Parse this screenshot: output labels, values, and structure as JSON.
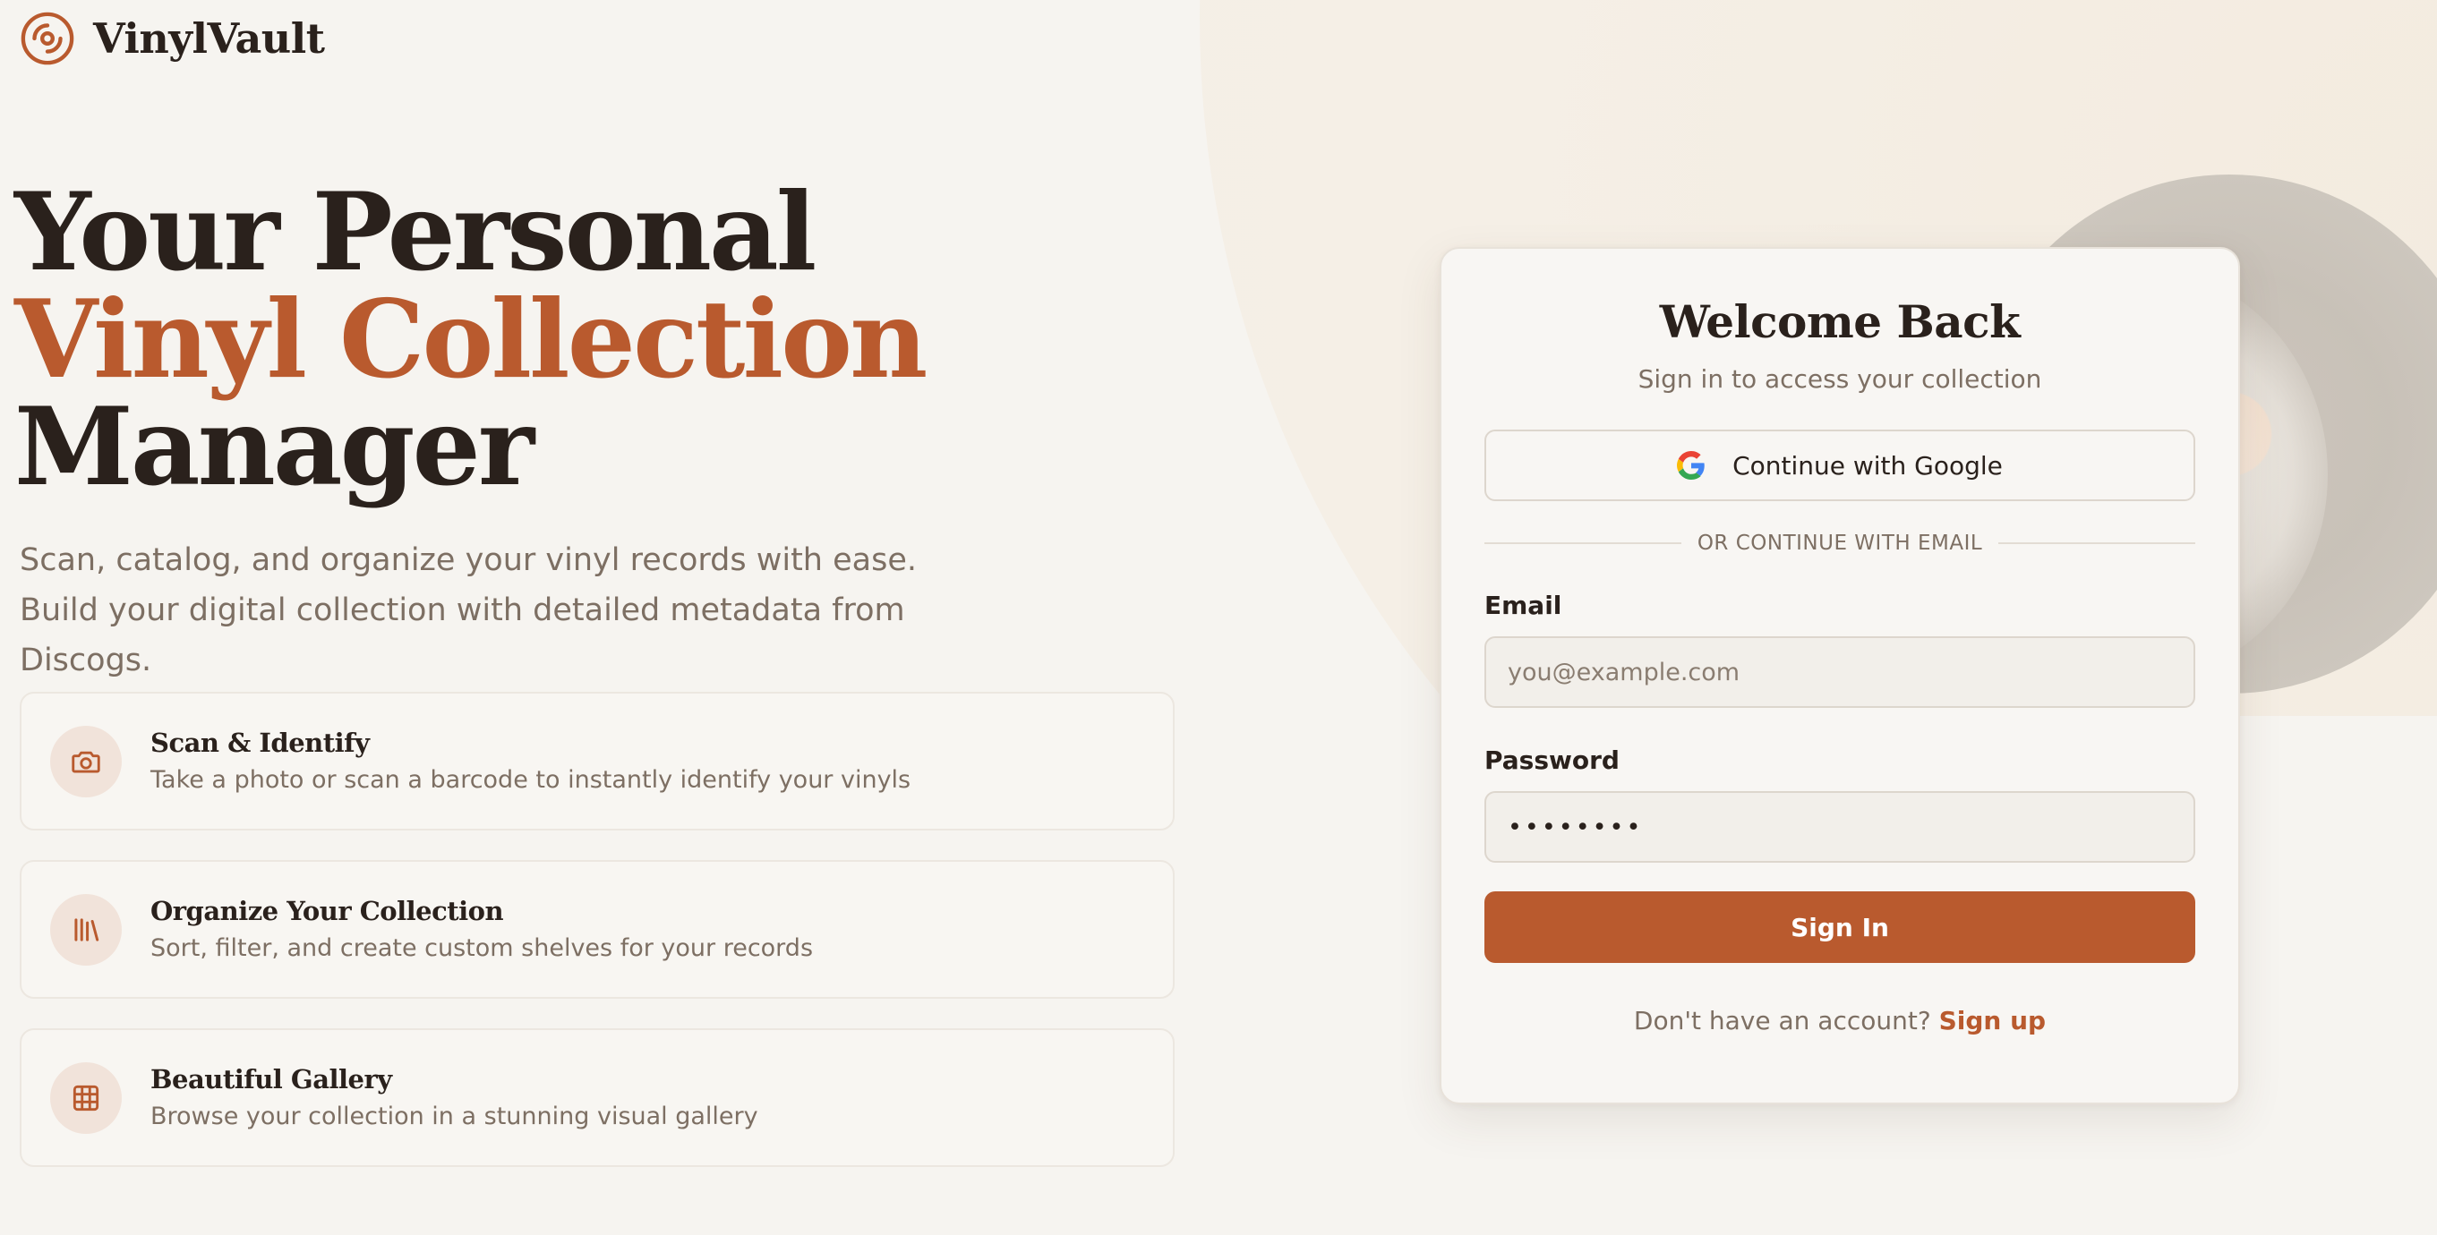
{
  "brand": {
    "name": "VinylVault",
    "icon": "disc-icon"
  },
  "hero": {
    "title_line1": "Your Personal",
    "title_line2": "Vinyl Collection",
    "title_line3": "Manager",
    "subtitle": "Scan, catalog, and organize your vinyl records with ease. Build your digital collection with detailed metadata from Discogs."
  },
  "features": [
    {
      "icon": "camera-icon",
      "title": "Scan & Identify",
      "description": "Take a photo or scan a barcode to instantly identify your vinyls"
    },
    {
      "icon": "library-icon",
      "title": "Organize Your Collection",
      "description": "Sort, filter, and create custom shelves for your records"
    },
    {
      "icon": "grid-icon",
      "title": "Beautiful Gallery",
      "description": "Browse your collection in a stunning visual gallery"
    }
  ],
  "login": {
    "title": "Welcome Back",
    "subtitle": "Sign in to access your collection",
    "google_label": "Continue with Google",
    "divider_label": "OR CONTINUE WITH EMAIL",
    "email_label": "Email",
    "email_placeholder": "you@example.com",
    "email_value": "",
    "password_label": "Password",
    "password_value": "password",
    "signin_label": "Sign In",
    "signup_prompt": "Don't have an account?",
    "signup_link": "Sign up"
  },
  "colors": {
    "accent": "#b95a2e",
    "heading": "#2a211c",
    "muted": "#7d6f63",
    "background": "#f6f4f0"
  }
}
